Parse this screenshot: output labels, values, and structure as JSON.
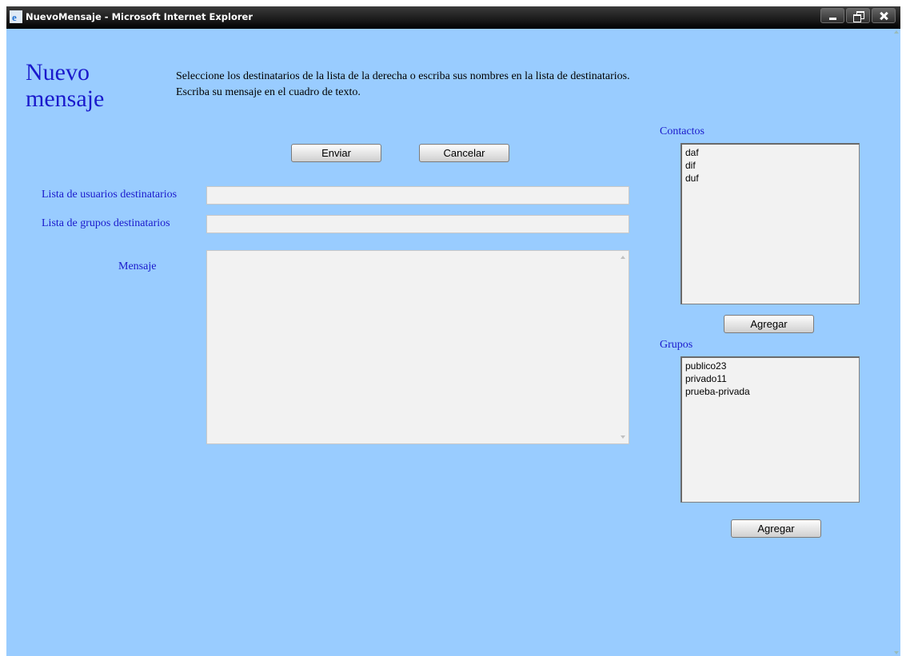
{
  "window": {
    "title": "NuevoMensaje - Microsoft Internet Explorer"
  },
  "page": {
    "title_line1": "Nuevo",
    "title_line2": "mensaje",
    "instructions_line1": "Seleccione los destinatarios de la lista de la derecha o escriba sus nombres en la lista de destinatarios.",
    "instructions_line2": "Escriba su mensaje en el cuadro de texto."
  },
  "actions": {
    "send_label": "Enviar",
    "cancel_label": "Cancelar"
  },
  "form": {
    "users_label": "Lista de usuarios destinatarios",
    "users_value": "",
    "groups_label": "Lista de grupos destinatarios",
    "groups_value": "",
    "message_label": "Mensaje",
    "message_value": ""
  },
  "contacts": {
    "label": "Contactos",
    "items": [
      "daf",
      "dif",
      "duf"
    ],
    "add_label": "Agregar"
  },
  "groups": {
    "label": "Grupos",
    "items": [
      "publico23",
      "privado11",
      "prueba-privada"
    ],
    "add_label": "Agregar"
  },
  "icons": {
    "browser": "internet-explorer-icon",
    "minimize": "minimize-icon",
    "maximize": "maximize-icon",
    "close": "close-icon"
  },
  "colors": {
    "background": "#99ccff",
    "label_text": "#1a1acc",
    "field_bg": "#f2f2f2"
  }
}
